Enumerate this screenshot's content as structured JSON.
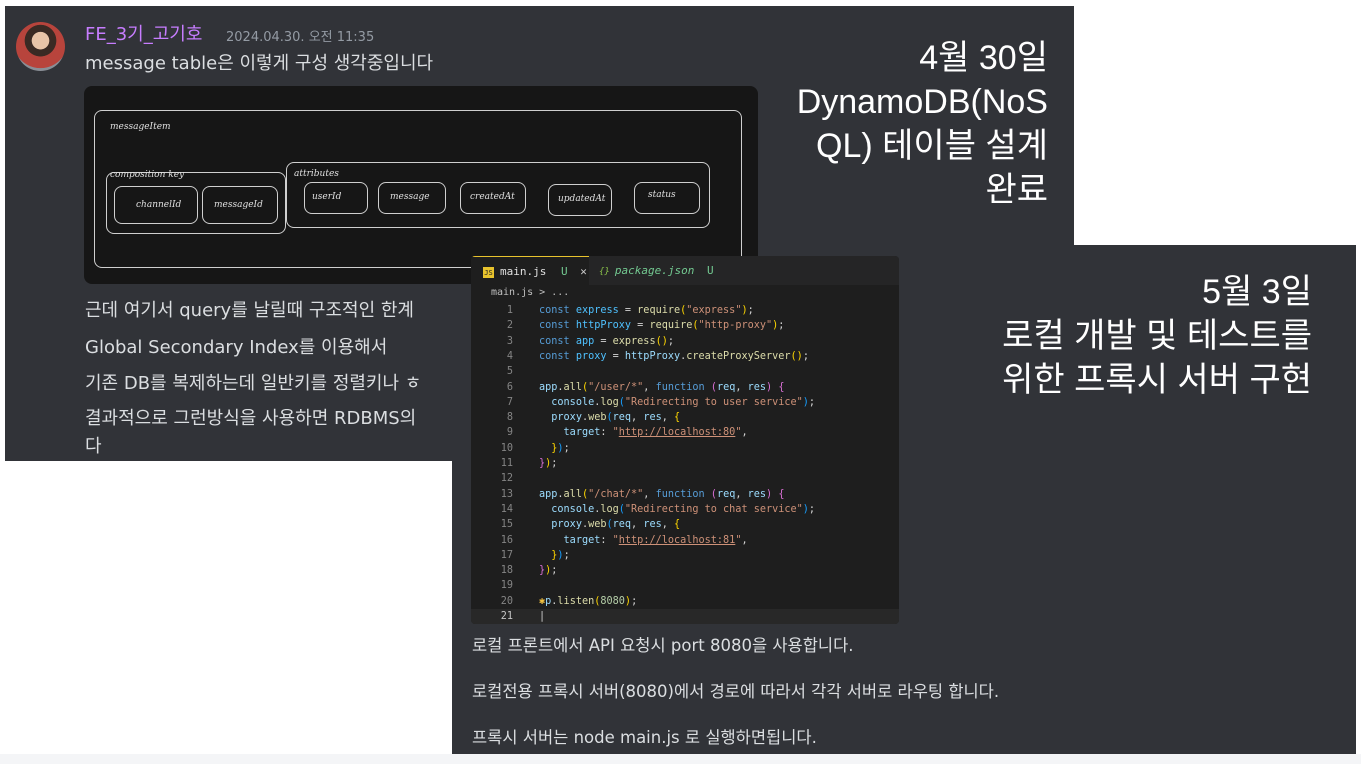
{
  "message1": {
    "username": "FE_3기_고기호",
    "timestamp": "2024.04.30. 오전 11:35",
    "text": "message table은 이렇게 구성 생각중입니다",
    "diagram": {
      "outer_label": "messageItem",
      "composition_label": "composition key",
      "composition_items": [
        "channelId",
        "messageId"
      ],
      "attributes_label": "attributes",
      "attribute_items": [
        "userId",
        "message",
        "createdAt",
        "updatedAt",
        "status"
      ]
    },
    "lines": [
      "근데 여기서 query를 날릴때 구조적인 한계",
      "Global Secondary Index를 이용해서",
      "기존 DB를 복제하는데 일반키를 정렬키나 ㅎ",
      "결과적으로 그런방식을 사용하면 RDBMS의",
      "다"
    ]
  },
  "overlay1": {
    "lines": [
      "4월 30일",
      "DynamoDB(NoS",
      "QL) 테이블 설계",
      "완료"
    ]
  },
  "overlay2": {
    "lines": [
      "5월 3일",
      "로컬 개발 및 테스트를",
      "위한 프록시 서버 구현"
    ]
  },
  "editor": {
    "tabs": [
      {
        "name": "main.js",
        "badge": "U",
        "close": "✕",
        "icon": "JS"
      },
      {
        "name": "package.json",
        "badge": "U",
        "icon": "{}"
      }
    ],
    "breadcrumb": "main.js > ...",
    "line_numbers": [
      "1",
      "2",
      "3",
      "4",
      "5",
      "6",
      "7",
      "8",
      "9",
      "10",
      "11",
      "12",
      "13",
      "14",
      "15",
      "16",
      "17",
      "18",
      "19",
      "20",
      "21"
    ]
  },
  "message2": {
    "lines": [
      "로컬 프론트에서 API 요청시 port 8080을 사용합니다.",
      "로컬전용 프록시 서버(8080)에서 경로에 따라서 각각 서버로 라우팅 합니다.",
      "프록시 서버는 node main.js 로 실행하면됩니다."
    ]
  }
}
